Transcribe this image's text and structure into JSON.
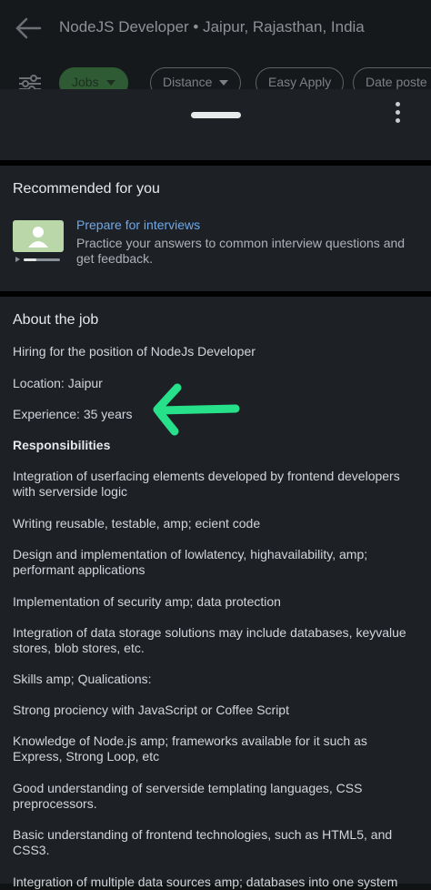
{
  "header": {
    "title": "NodeJS Developer • Jaipur, Rajasthan, India",
    "back_icon": "arrow-left-icon"
  },
  "filters": [
    {
      "label": "Jobs",
      "active": true,
      "dropdown": true
    },
    {
      "label": "Distance",
      "active": false,
      "dropdown": true
    },
    {
      "label": "Easy Apply",
      "active": false,
      "dropdown": false
    },
    {
      "label": "Date poste",
      "active": false,
      "dropdown": false
    }
  ],
  "recommended": {
    "title": "Recommended for you",
    "link": "Prepare for interviews",
    "description": "Practice your answers to common interview questions and get feedback."
  },
  "about": {
    "title": "About the job",
    "lines": [
      "Hiring for the position of NodeJs Developer",
      "Location: Jaipur",
      "Experience: 35 years",
      "Responsibilities",
      "Integration of userfacing elements developed by frontend developers with serverside logic",
      "Writing reusable, testable, amp; ecient code",
      "Design and implementation of lowlatency, highavailability, amp; performant applications",
      "Implementation of security amp; data protection",
      "Integration of data storage solutions may include databases, keyvalue stores, blob stores, etc.",
      "Skills amp; Qualications:",
      "Strong prociency with JavaScript or Coffee Script",
      "Knowledge of Node.js amp; frameworks available for it such as Express, Strong Loop, etc",
      "Good understanding of serverside templating languages, CSS preprocessors.",
      "Basic understanding of frontend technologies, such as HTML5, and CSS3.",
      "Integration of multiple data sources amp; databases into one system"
    ]
  },
  "colors": {
    "annotation_arrow": "#27e08a",
    "link": "#6fa8e8",
    "active_chip": "#2f5b34"
  }
}
